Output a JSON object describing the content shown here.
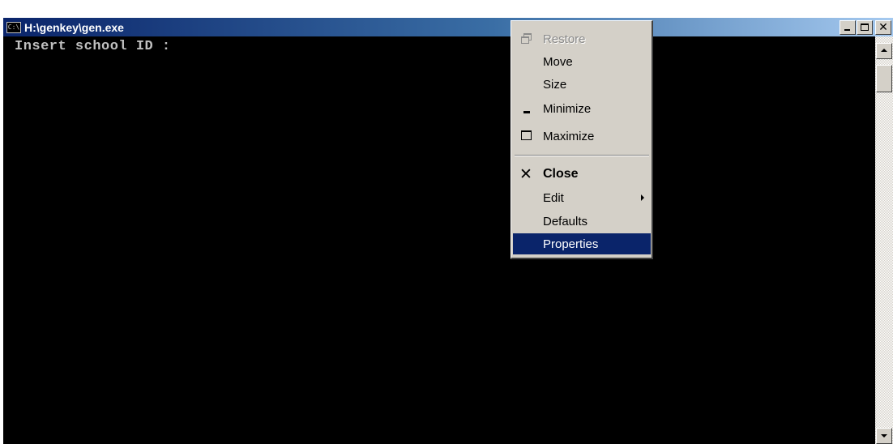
{
  "window": {
    "title": "H:\\genkey\\gen.exe",
    "icon": "console-app-icon",
    "icon_text": "C:\\",
    "buttons": {
      "minimize": "minimize-icon",
      "maximize": "maximize-icon",
      "close": "close-icon"
    }
  },
  "console": {
    "line1": "Insert school ID :"
  },
  "system_menu": {
    "items": [
      {
        "label": "Restore",
        "icon": "restore-icon",
        "disabled": true
      },
      {
        "label": "Move"
      },
      {
        "label": "Size"
      },
      {
        "label": "Minimize",
        "icon": "minimize-icon"
      },
      {
        "label": "Maximize",
        "icon": "maximize-icon"
      },
      {
        "label": "Close",
        "icon": "close-icon",
        "bold": true
      },
      {
        "label": "Edit",
        "submenu": true
      },
      {
        "label": "Defaults"
      },
      {
        "label": "Properties",
        "selected": true
      }
    ]
  },
  "colors": {
    "titlebar_start": "#0a246a",
    "titlebar_end": "#a6caf0",
    "console_bg": "#000000",
    "console_text": "#c0c0c0",
    "menu_bg": "#d4d0c8",
    "selection": "#0a246a"
  }
}
